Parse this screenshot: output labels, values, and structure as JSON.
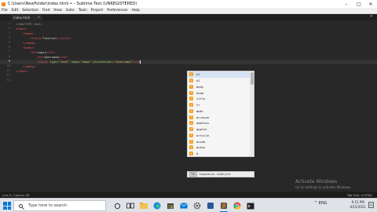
{
  "window": {
    "title": "C:\\Users\\NewFolder\\index.html • – Sublime Text (UNREGISTERED)",
    "controls": {
      "minimize": "–",
      "maximize": "□",
      "close": "✕"
    }
  },
  "menu": [
    "File",
    "Edit",
    "Selection",
    "Find",
    "View",
    "Goto",
    "Tools",
    "Project",
    "Preferences",
    "Help"
  ],
  "tab": {
    "label": "index.html",
    "close": "×",
    "overflow": "▾"
  },
  "editor": {
    "line_numbers": [
      "1",
      "2",
      "3",
      "4",
      "5",
      "6",
      "7",
      "8",
      "9",
      "10",
      "11",
      "12",
      "13"
    ],
    "current_line": "9",
    "lines": [
      {
        "parts": [
          {
            "c": "t-dt",
            "t": "<!DOCTYPE html>"
          }
        ]
      },
      {
        "parts": [
          {
            "c": "t-tag",
            "t": "<html>"
          }
        ]
      },
      {
        "parts": [
          {
            "c": "t-tag",
            "t": "    <head>"
          }
        ]
      },
      {
        "parts": [
          {
            "c": "t-tag",
            "t": "        <title>"
          },
          {
            "c": "t-txt",
            "t": "Tutorial"
          },
          {
            "c": "t-tag",
            "t": "</title>"
          }
        ]
      },
      {
        "parts": [
          {
            "c": "t-tag",
            "t": "    </head>"
          }
        ]
      },
      {
        "parts": [
          {
            "c": "t-tag",
            "t": "    <body>"
          }
        ]
      },
      {
        "parts": [
          {
            "c": "t-tag",
            "t": "        <h1>"
          },
          {
            "c": "t-txt",
            "t": "Login"
          },
          {
            "c": "t-tag",
            "t": "</h1>"
          }
        ]
      },
      {
        "parts": [
          {
            "c": "t-tag",
            "t": "            <h2>"
          },
          {
            "c": "t-txt",
            "t": "Username"
          },
          {
            "c": "t-tag",
            "t": "</h2>"
          }
        ]
      },
      {
        "parts": [
          {
            "c": "t-tag",
            "t": "            <input "
          },
          {
            "c": "t-attr",
            "t": "type="
          },
          {
            "c": "t-str",
            "t": "\"text\" "
          },
          {
            "c": "t-attr",
            "t": "name="
          },
          {
            "c": "t-str",
            "t": "\"name\" "
          },
          {
            "c": "t-attr",
            "t": "placeholder="
          },
          {
            "c": "t-str",
            "t": "\"Username\""
          },
          {
            "c": "t-tag",
            "t": "></h"
          }
        ]
      },
      {
        "parts": [
          {
            "c": "t-tag",
            "t": "    </body>"
          }
        ]
      },
      {
        "parts": [
          {
            "c": "t-tag",
            "t": "</html>"
          }
        ]
      },
      {
        "parts": []
      },
      {
        "parts": []
      }
    ]
  },
  "autocomplete": {
    "items": [
      "h1",
      "h2",
      "body",
      "head",
      "title",
      "tr",
      "abbr",
      "acronym",
      "address",
      "applet",
      "article",
      "aside",
      "audio",
      "b"
    ],
    "selected_index": 0,
    "kind_glyph": "f",
    "hint_key": "Tab",
    "hint_text": "Expands to:",
    "hint_value": "h1$0</h1>"
  },
  "watermark": {
    "title": "Activate Windows",
    "subtitle": "Go to Settings to activate Windows."
  },
  "statusbar": {
    "left": "Line 9, Column 95",
    "right": "Tab Size: 4    HTML"
  },
  "taskbar": {
    "search_placeholder": "Type here to search",
    "tray": "^  ENG",
    "time": "9:51 PM",
    "date": "4/15/2021"
  },
  "colors": {
    "accent": "#0078d7",
    "editor_bg": "#282828",
    "tag": "#f05a5a",
    "attr": "#a6d15a",
    "string": "#e6c35c"
  }
}
